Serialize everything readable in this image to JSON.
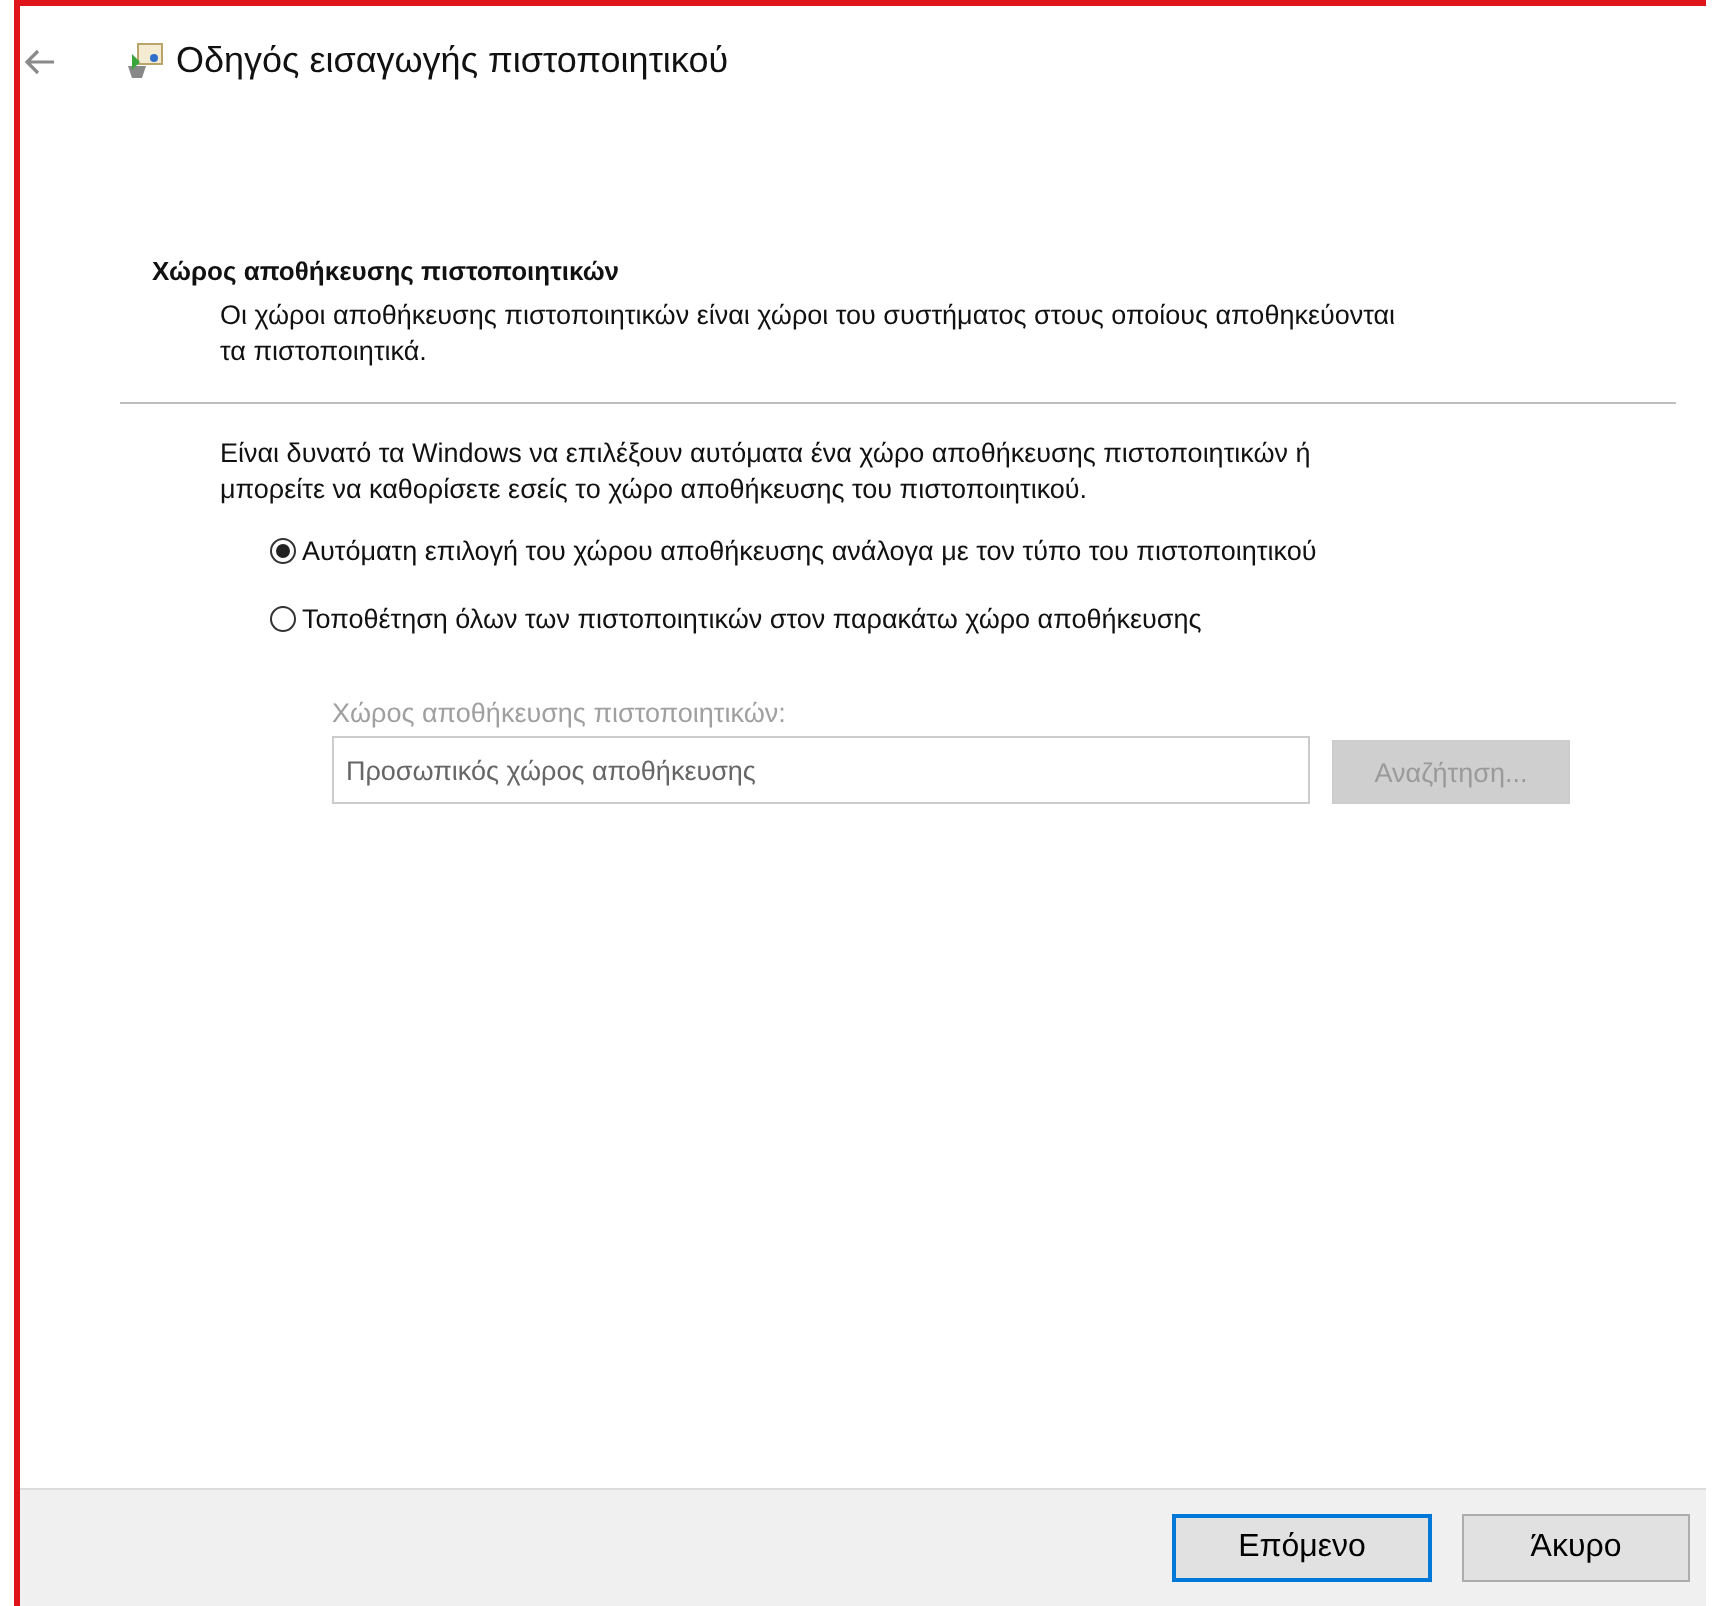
{
  "window": {
    "title": "Οδηγός εισαγωγής πιστοποιητικού"
  },
  "section": {
    "heading": "Χώρος αποθήκευσης πιστοποιητικών",
    "description": "Οι χώροι αποθήκευσης πιστοποιητικών είναι χώροι του συστήματος στους οποίους αποθηκεύονται τα πιστοποιητικά."
  },
  "intro": "Είναι δυνατό τα Windows να επιλέξουν αυτόματα ένα χώρο αποθήκευσης πιστοποιητικών ή μπορείτε να καθορίσετε εσείς το χώρο αποθήκευσης του πιστοποιητικού.",
  "options": [
    {
      "label": "Αυτόματη επιλογή του χώρου αποθήκευσης ανάλογα με τον τύπο του πιστοποιητικού",
      "selected": true
    },
    {
      "label": "Τοποθέτηση όλων των πιστοποιητικών στον παρακάτω χώρο αποθήκευσης",
      "selected": false
    }
  ],
  "store": {
    "label": "Χώρος αποθήκευσης πιστοποιητικών:",
    "value": "Προσωπικός χώρος αποθήκευσης",
    "button": "Αναζήτηση...",
    "disabled": true
  },
  "buttons": [
    {
      "label": "Επόμενο",
      "default": true
    },
    {
      "label": "Άκυρο",
      "default": false
    }
  ]
}
